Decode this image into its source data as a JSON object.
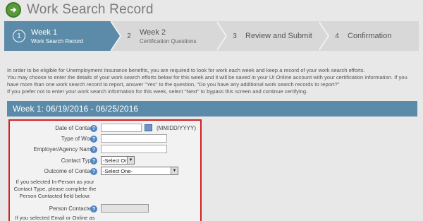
{
  "header": {
    "title": "Work Search Record",
    "logo_icon": "circle-arrow-icon"
  },
  "steps": [
    {
      "num": "1",
      "label": "Week 1",
      "sub": "Work Search Record",
      "active": true
    },
    {
      "num": "2",
      "label": "Week 2",
      "sub": "Certification Questions",
      "active": false
    },
    {
      "num": "3",
      "label": "Review and Submit",
      "sub": "",
      "active": false
    },
    {
      "num": "4",
      "label": "Confirmation",
      "sub": "",
      "active": false
    }
  ],
  "intro": {
    "line1": "In order to be eligible for Unemployment Insurance benefits, you are required to look for work each week and keep a record of your work search efforts.",
    "line2": "You may choose to enter the details of your work search efforts below for this week and it will be saved in your UI Online account with your certification information. If you have more than one work search record to report, answer \"Yes\" to the question, \"Do you have any additional work search records to report?\"",
    "line3": "If you prefer not to enter your work search information for this week, select \"Next\" to bypass this screen and continue certifying."
  },
  "week_bar": {
    "label": "Week 1: 06/19/2016 - 06/25/2016"
  },
  "form": {
    "date_label": "Date of Contact:",
    "date_value": "",
    "date_format": "(MM/DD/YYYY)",
    "type_label": "Type of Work:",
    "type_value": "",
    "employer_label": "Employer/Agency Name:",
    "employer_value": "",
    "contact_type_label": "Contact Type:",
    "contact_type_value": "-Select One-",
    "outcome_label": "Outcome of Contact:",
    "outcome_value": "-Select One-",
    "inperson_note": "If you selected In-Person as your Contact Type, please complete the Person Contacted field below:",
    "person_label": "Person Contacted:",
    "person_value": "",
    "email_note": "If you selected Email or Online as",
    "help_glyph": "?",
    "dropdown_glyph": "▼"
  }
}
